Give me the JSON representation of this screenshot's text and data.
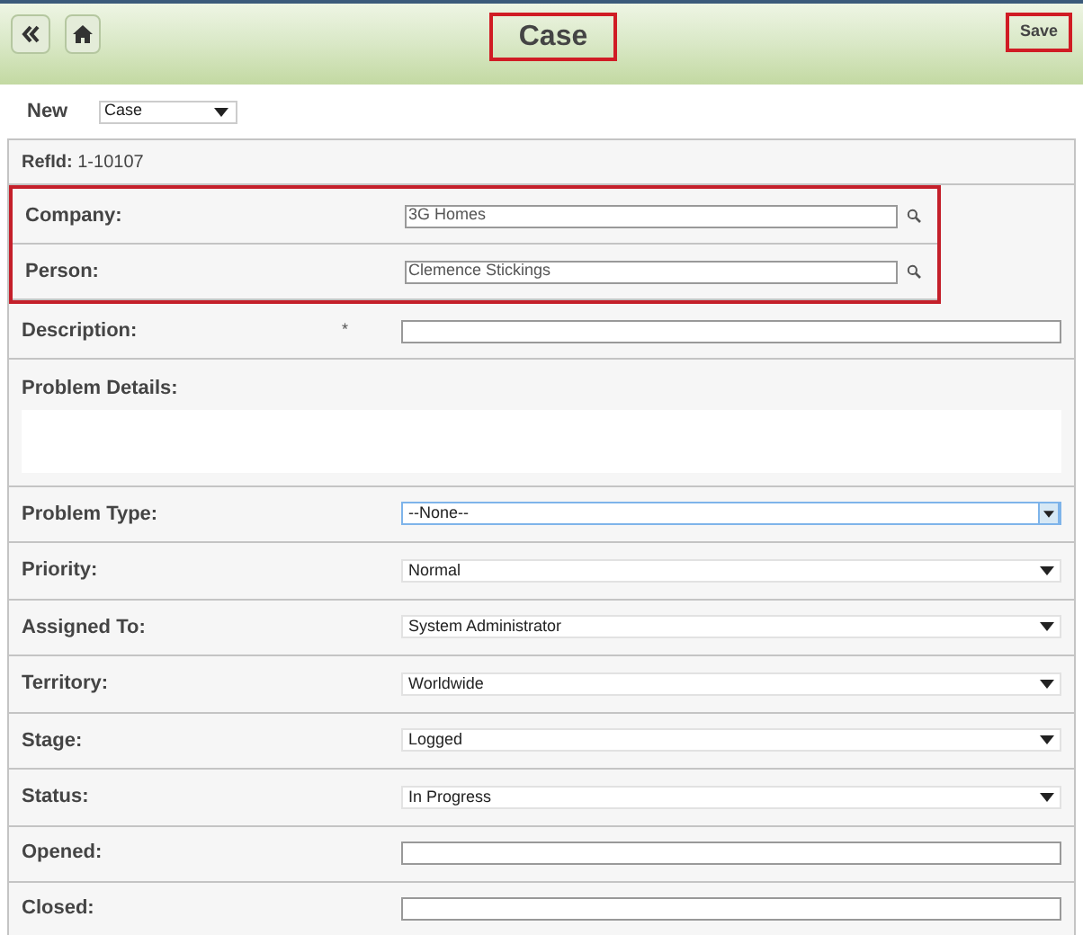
{
  "header": {
    "title": "Case",
    "title_highlighted": true,
    "save": "Save",
    "save_highlighted": true
  },
  "new_bar": {
    "label": "New",
    "select": "Case"
  },
  "refid": {
    "label": "RefId:",
    "value": "1-10107"
  },
  "rows": [
    {
      "kind": "lookup",
      "label": "Company:",
      "value": "3G Homes",
      "highlighted": true
    },
    {
      "kind": "lookup",
      "label": "Person:",
      "value": "Clemence Stickings",
      "highlighted": true
    },
    {
      "kind": "text",
      "label": "Description:",
      "required_mark": "*",
      "value": "",
      "highlighted": false
    },
    {
      "kind": "textarea",
      "label": "Problem Details:",
      "highlighted": false
    },
    {
      "kind": "select",
      "label": "Problem Type:",
      "value": "--None--",
      "focused": true,
      "highlighted": false
    },
    {
      "kind": "select",
      "label": "Priority:",
      "value": "Normal",
      "focused": false,
      "highlighted": false
    },
    {
      "kind": "select",
      "label": "Assigned To:",
      "value": "System Administrator",
      "focused": false,
      "highlighted": false
    },
    {
      "kind": "select",
      "label": "Territory:",
      "value": "Worldwide",
      "focused": false,
      "highlighted": false
    },
    {
      "kind": "select",
      "label": "Stage:",
      "value": "Logged",
      "focused": false,
      "highlighted": false
    },
    {
      "kind": "select",
      "label": "Status:",
      "value": "In Progress",
      "focused": false,
      "highlighted": false
    },
    {
      "kind": "text",
      "label": "Opened:",
      "value": "",
      "highlighted": false
    },
    {
      "kind": "text",
      "label": "Closed:",
      "value": "",
      "highlighted": false
    }
  ]
}
